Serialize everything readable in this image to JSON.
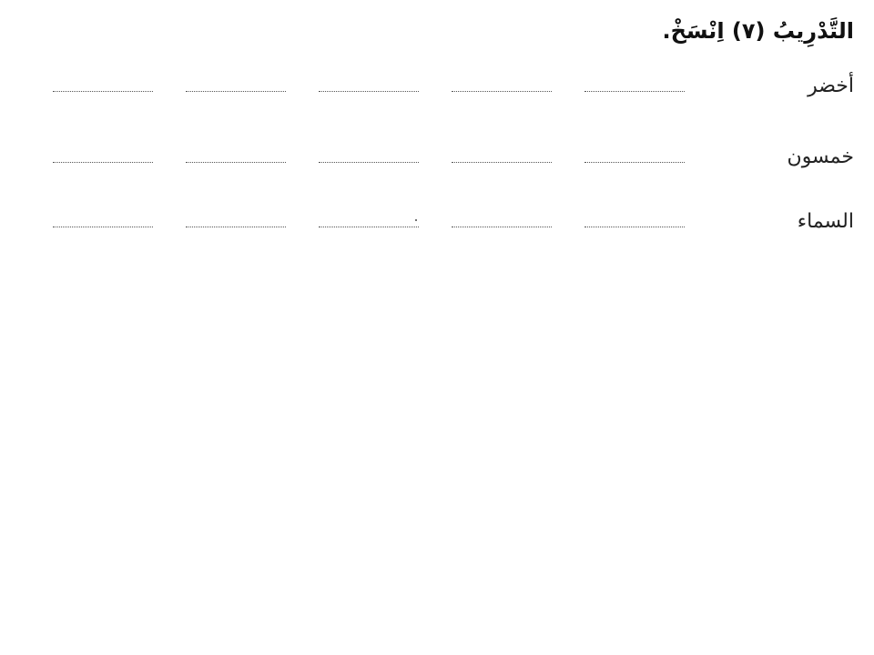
{
  "exercise": {
    "title": "التَّدْرِيبُ (٧) اِنْسَخْ."
  },
  "rows": [
    {
      "word": "أخضر",
      "blanks": 5
    },
    {
      "word": "خمسون",
      "blanks": 5
    },
    {
      "word": "السماء",
      "blanks": 5
    }
  ]
}
